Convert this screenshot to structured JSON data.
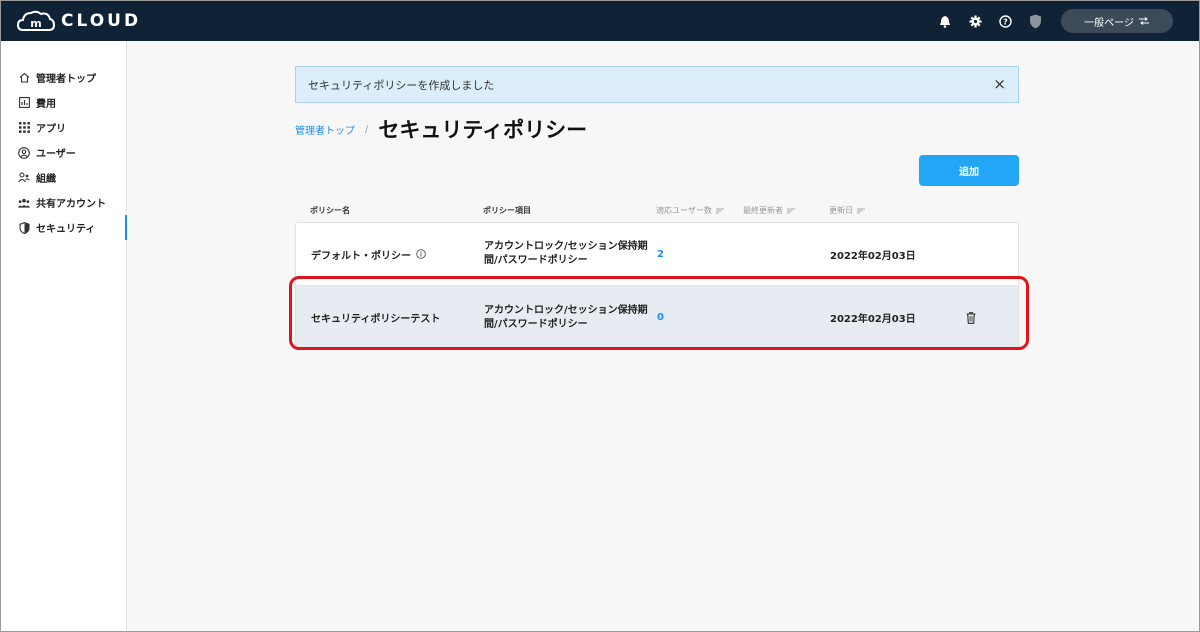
{
  "app": {
    "logo_text": "CLOUD"
  },
  "topbar": {
    "switch_label": "一般ページ"
  },
  "sidebar": {
    "items": [
      {
        "label": "管理者トップ",
        "icon": "home-icon"
      },
      {
        "label": "費用",
        "icon": "chart-icon"
      },
      {
        "label": "アプリ",
        "icon": "grid-icon"
      },
      {
        "label": "ユーザー",
        "icon": "user-icon"
      },
      {
        "label": "組織",
        "icon": "group-icon"
      },
      {
        "label": "共有アカウント",
        "icon": "shared-users-icon"
      },
      {
        "label": "セキュリティ",
        "icon": "shield-icon",
        "active": true
      }
    ]
  },
  "alert": {
    "message": "セキュリティポリシーを作成しました"
  },
  "breadcrumb": {
    "parent": "管理者トップ",
    "sep": "/"
  },
  "page": {
    "title": "セキュリティポリシー"
  },
  "actions": {
    "add_label": "追加"
  },
  "table": {
    "headers": {
      "name": "ポリシー名",
      "items": "ポリシー項目",
      "users": "適応ユーザー数",
      "updater": "最終更新者",
      "updated": "更新日"
    },
    "rows": [
      {
        "name": "デフォルト・ポリシー",
        "items_line1": "アカウントロック/セッション保持期",
        "items_line2": "間/パスワードポリシー",
        "users": "2",
        "updated": "2022年02月03日"
      },
      {
        "name": "セキュリティポリシーテスト",
        "items_line1": "アカウントロック/セッション保持期",
        "items_line2": "間/パスワードポリシー",
        "users": "0",
        "updated": "2022年02月03日"
      }
    ]
  },
  "colors": {
    "topbar": "#102236",
    "accent": "#23a6f5",
    "highlight": "#e0141e"
  }
}
